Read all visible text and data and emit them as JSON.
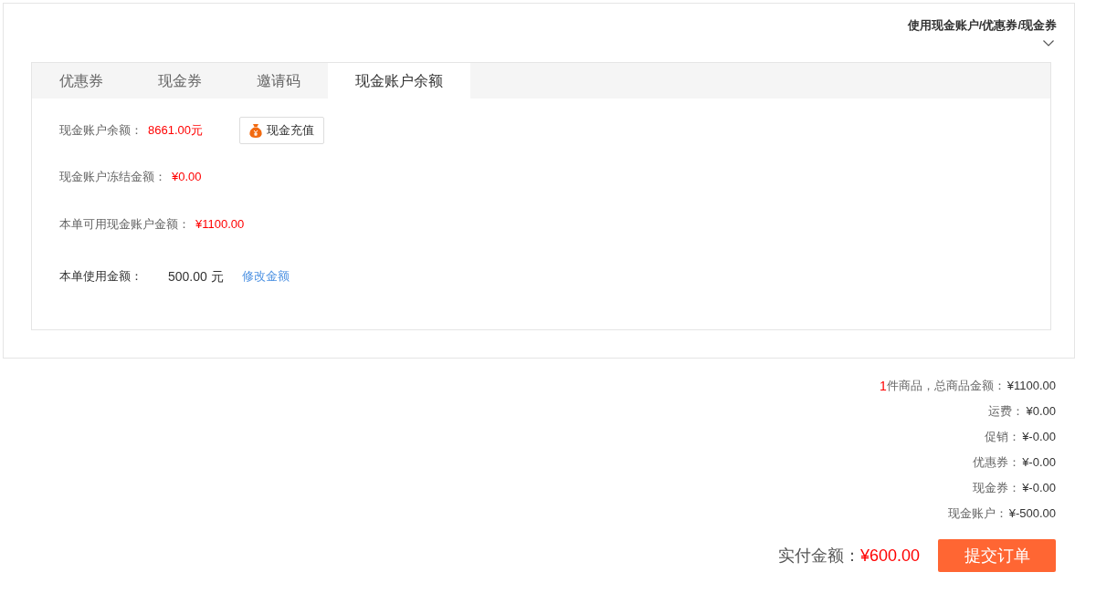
{
  "coupon_panel": {
    "title": "使用现金账户/优惠券/现金券",
    "expanded": true
  },
  "tabs": [
    {
      "label": "优惠券",
      "selected": false
    },
    {
      "label": "现金券",
      "selected": false
    },
    {
      "label": "邀请码",
      "selected": false
    },
    {
      "label": "现金账户余额",
      "selected": true
    }
  ],
  "cash_account": {
    "balance": {
      "label": "现金账户余额：",
      "value": "8661.00元"
    },
    "recharge_button": "现金充值",
    "frozen": {
      "label": "现金账户冻结金额：",
      "value": "¥0.00"
    },
    "available": {
      "label": "本单可用现金账户金额：",
      "value": "¥1100.00"
    },
    "use_amount": {
      "label": "本单使用金额：",
      "value": "500.00 元",
      "link": "修改金额"
    }
  },
  "summary": [
    {
      "kind": "count",
      "count": "1",
      "label": "件商品，总商品金额：",
      "value": "¥1100.00"
    },
    {
      "kind": "plain",
      "label": "运费：",
      "value": "¥0.00"
    },
    {
      "kind": "plain",
      "label": "促销：",
      "value": "¥-0.00"
    },
    {
      "kind": "plain",
      "label": "优惠券：",
      "value": "¥-0.00"
    },
    {
      "kind": "plain",
      "label": "现金券：",
      "value": "¥-0.00"
    },
    {
      "kind": "plain",
      "label": "现金账户：",
      "value": "¥-500.00"
    }
  ],
  "total": {
    "label": "实付金额：",
    "value": "¥600.00"
  },
  "submit_button": "提交订单"
}
